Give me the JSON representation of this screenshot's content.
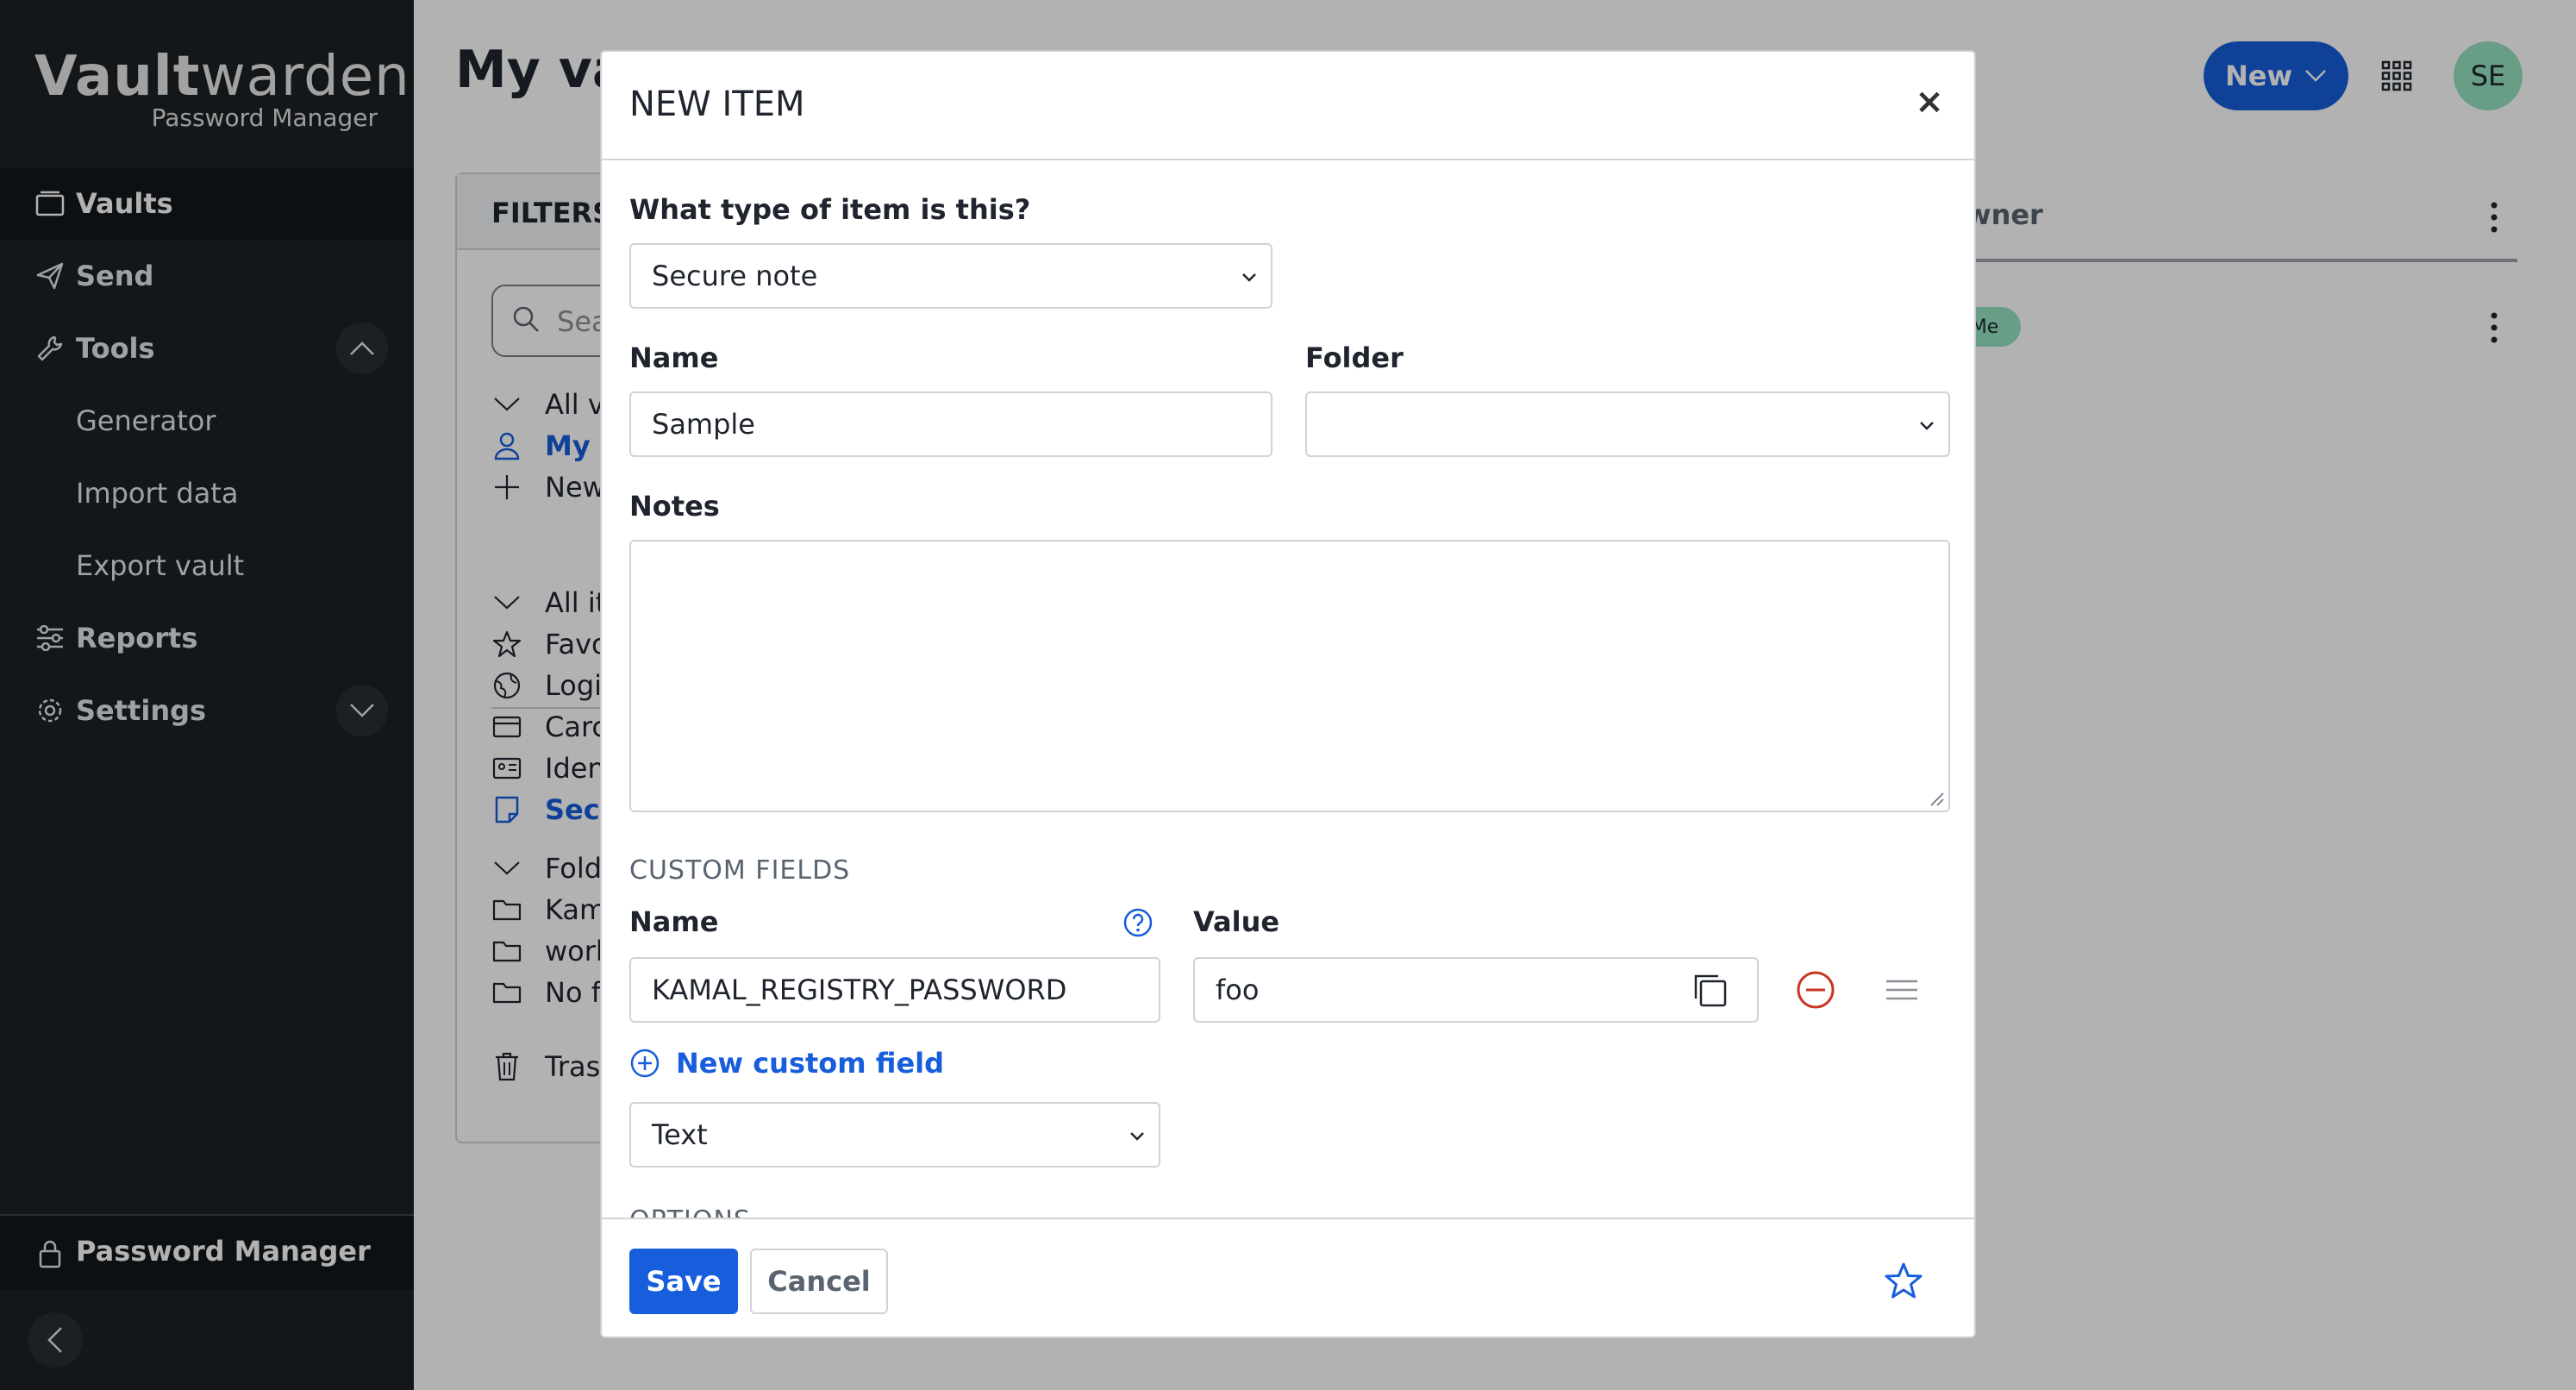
{
  "sidebar": {
    "logo_main_bold": "V",
    "logo_main_strong": "ault",
    "logo_main_rest": "warden",
    "logo_sub": "Password Manager",
    "items": [
      {
        "label": "Vaults",
        "icon": "vault-icon"
      },
      {
        "label": "Send",
        "icon": "send-icon"
      },
      {
        "label": "Tools",
        "icon": "wrench-icon"
      },
      {
        "label": "Generator"
      },
      {
        "label": "Import data"
      },
      {
        "label": "Export vault"
      },
      {
        "label": "Reports",
        "icon": "sliders-icon"
      },
      {
        "label": "Settings",
        "icon": "gear-icon"
      }
    ],
    "bottom_label": "Password Manager"
  },
  "main": {
    "title": "My va",
    "new_button": "New",
    "avatar_initials": "SE",
    "filters_title": "FILTERS",
    "search_placeholder": "Sea",
    "filter_rows": [
      "All v",
      "My v",
      "New",
      "All it",
      "Favo",
      "Logi",
      "Carc",
      "Iden",
      "Secu",
      "Fold",
      "Kam",
      "work",
      "No f",
      "Tras"
    ],
    "owner_header": "wner",
    "me_badge": "Me"
  },
  "modal": {
    "title": "NEW ITEM",
    "close": "×",
    "type_label": "What type of item is this?",
    "type_value": "Secure note",
    "name_label": "Name",
    "name_value": "Sample",
    "folder_label": "Folder",
    "folder_value": "",
    "notes_label": "Notes",
    "notes_value": "",
    "custom_fields_header": "CUSTOM FIELDS",
    "cf_name_label": "Name",
    "cf_value_label": "Value",
    "cf_name_value": "KAMAL_REGISTRY_PASSWORD",
    "cf_value_value": "foo",
    "new_custom_field": "New custom field",
    "cf_type_value": "Text",
    "options_header": "OPTIONS",
    "save": "Save",
    "cancel": "Cancel"
  },
  "colors": {
    "primary": "#175ddc",
    "sidebar_bg": "#1d2226",
    "avatar_bg": "#96e3c1",
    "danger": "#c83522"
  }
}
